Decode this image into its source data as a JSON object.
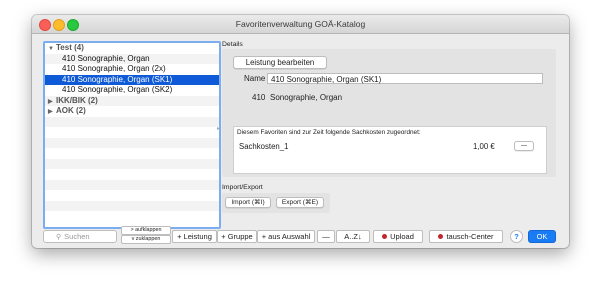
{
  "window": {
    "title": "Favoritenverwaltung GOÄ-Katalog"
  },
  "tree": {
    "items": [
      {
        "type": "group",
        "label": "Test (4)",
        "expanded": true
      },
      {
        "type": "item",
        "label": "410 Sonographie, Organ"
      },
      {
        "type": "item",
        "label": "410 Sonographie, Organ (2x)"
      },
      {
        "type": "item",
        "label": "410 Sonographie, Organ (SK1)",
        "selected": true
      },
      {
        "type": "item",
        "label": "410 Sonographie, Organ (SK2)"
      },
      {
        "type": "group",
        "label": "IKK/BIK (2)",
        "expanded": false
      },
      {
        "type": "group",
        "label": "AOK (2)",
        "expanded": false
      }
    ],
    "selection_color": "#0f5ad6"
  },
  "details": {
    "section_label": "Details",
    "edit_button": "Leistung bearbeiten",
    "name_label": "Name",
    "name_value": "410 Sonographie, Organ (SK1)",
    "code": "410",
    "code_description": "Sonographie, Organ",
    "sachkosten_text": "Diesem Favoriten sind zur Zeit folgende Sachkosten zugeordnet:",
    "sachkosten_items": [
      {
        "name": "Sachkosten_1",
        "amount": "1,00 €",
        "remove": "—"
      }
    ]
  },
  "import_export": {
    "section_label": "Import/Export",
    "import_button": "Import (⌘I)",
    "export_button": "Export (⌘E)"
  },
  "toolbar": {
    "search_placeholder": "Suchen",
    "expand": "> aufklappen",
    "collapse": "v zuklappen",
    "add_service": "+ Leistung",
    "add_group": "+ Gruppe",
    "add_from_selection": "+ aus Auswahl",
    "remove": "—",
    "sort": "A..Z↓",
    "upload": "Upload",
    "exchange": "tausch-Center",
    "help": "?",
    "ok": "OK"
  },
  "colors": {
    "accent": "#1a7cf5",
    "dot": "#c0262d"
  }
}
